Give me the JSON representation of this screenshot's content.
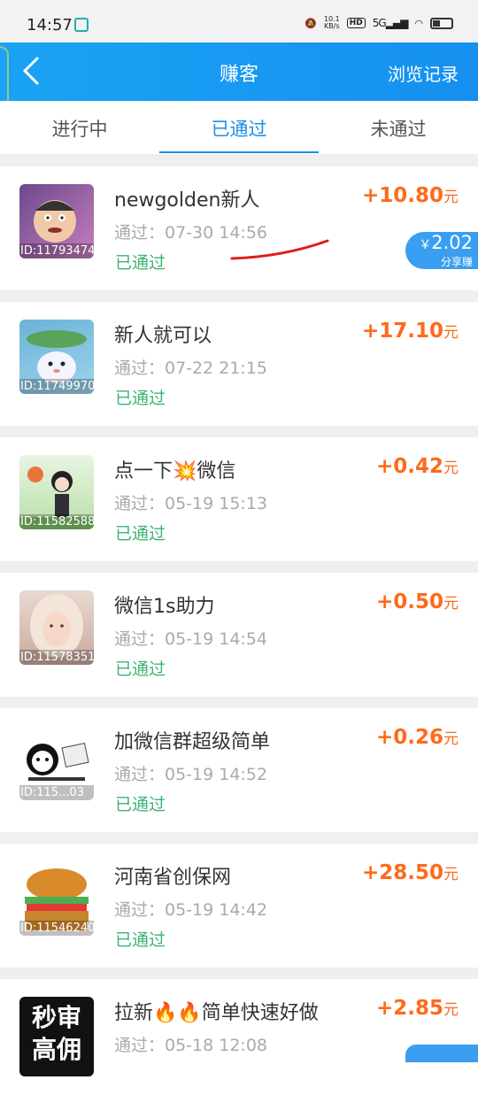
{
  "status_bar": {
    "time": "14:57",
    "net_speed": "10.1",
    "net_unit": "KB/s",
    "hd": "HD",
    "signal": "5G"
  },
  "header": {
    "title": "赚客",
    "history_label": "浏览记录"
  },
  "tabs": [
    {
      "label": "进行中",
      "active": false
    },
    {
      "label": "已通过",
      "active": true
    },
    {
      "label": "未通过",
      "active": false
    }
  ],
  "items": [
    {
      "id": "ID:11793474",
      "name": "newgolden新人",
      "time": "通过：07-30 14:56",
      "status": "已通过",
      "reward": "+10.80",
      "unit": "元",
      "share_amount": "2.02",
      "share_label": "分享赚"
    },
    {
      "id": "ID:11749970",
      "name": "新人就可以",
      "time": "通过：07-22 21:15",
      "status": "已通过",
      "reward": "+17.10",
      "unit": "元"
    },
    {
      "id": "ID:11582588",
      "name": "点一下💥微信",
      "time": "通过：05-19 15:13",
      "status": "已通过",
      "reward": "+0.42",
      "unit": "元"
    },
    {
      "id": "ID:11578351",
      "name": "微信1s助力",
      "time": "通过：05-19 14:54",
      "status": "已通过",
      "reward": "+0.50",
      "unit": "元"
    },
    {
      "id": "ID:115...03",
      "name": "加微信群超级简单",
      "time": "通过：05-19 14:52",
      "status": "已通过",
      "reward": "+0.26",
      "unit": "元"
    },
    {
      "id": "ID:11546240",
      "name": "河南省创保网",
      "time": "通过：05-19 14:42",
      "status": "已通过",
      "reward": "+28.50",
      "unit": "元"
    },
    {
      "id": "",
      "name": "拉新🔥🔥简单快速好做",
      "time": "通过：05-18 12:08",
      "status": "",
      "reward": "+2.85",
      "unit": "元",
      "thumb_text": "秒审高佣"
    }
  ],
  "colors": {
    "header_bg": "#1a9cf2",
    "accent": "#1a8fe8",
    "reward": "#ff6a1a",
    "status": "#3cb371"
  }
}
